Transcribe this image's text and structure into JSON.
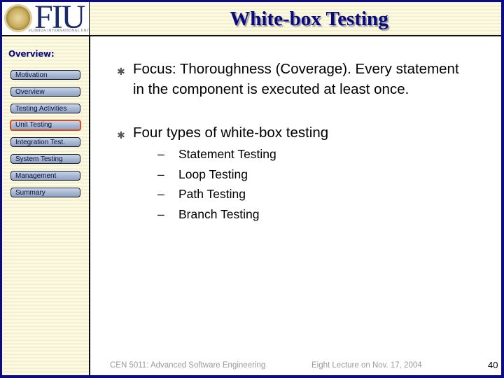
{
  "header": {
    "logo_text": "FIU",
    "logo_subtext": "FLORIDA INTERNATIONAL UNIVERSITY",
    "title": "White-box Testing"
  },
  "sidebar": {
    "heading": "Overview:",
    "items": [
      {
        "label": "Motivation",
        "active": false
      },
      {
        "label": "Overview",
        "active": false
      },
      {
        "label": "Testing Activities",
        "active": false
      },
      {
        "label": "Unit Testing",
        "active": true
      },
      {
        "label": "Integration Test.",
        "active": false
      },
      {
        "label": "System Testing",
        "active": false
      },
      {
        "label": "Management",
        "active": false
      },
      {
        "label": "Summary",
        "active": false
      }
    ]
  },
  "content": {
    "bullet_icon": "asterisk-icon",
    "bullets": [
      {
        "text": "Focus: Thoroughness (Coverage). Every statement in the component is executed at least once."
      },
      {
        "text": "Four types of white-box  testing"
      }
    ],
    "sub_items": [
      {
        "dash": "–",
        "text": "Statement Testing"
      },
      {
        "dash": "–",
        "text": "Loop Testing"
      },
      {
        "dash": "–",
        "text": "Path Testing"
      },
      {
        "dash": "–",
        "text": "Branch Testing"
      }
    ]
  },
  "footer": {
    "course": "CEN 5011: Advanced Software Engineering",
    "lecture": "Eight Lecture on Nov. 17, 2004",
    "page_number": "40"
  },
  "colors": {
    "frame": "#0b0b86",
    "title": "#0a0a80",
    "active_border": "#e0471e",
    "footer_text": "#9a9a9a"
  }
}
